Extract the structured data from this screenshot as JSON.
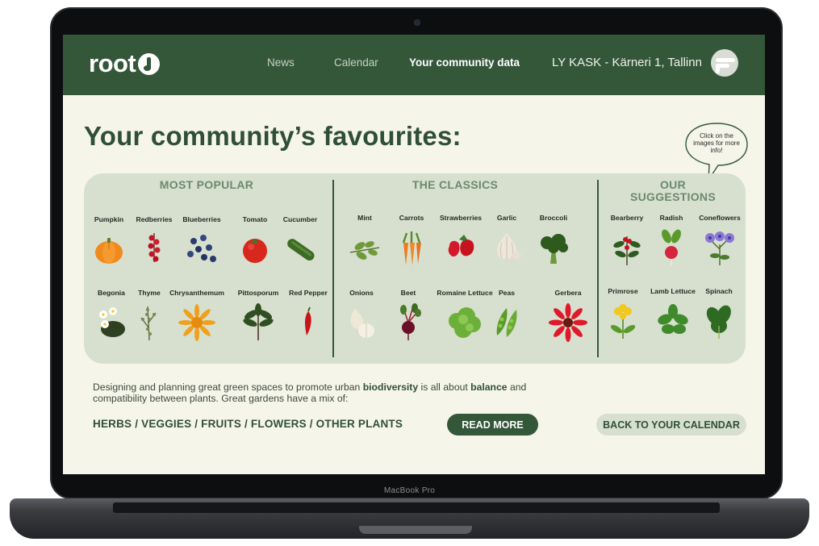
{
  "device": {
    "label": "MacBook Pro"
  },
  "app": {
    "logo_text": "root"
  },
  "nav": {
    "items": [
      {
        "label": "News",
        "active": false
      },
      {
        "label": "Calendar",
        "active": false
      },
      {
        "label": "Your community data",
        "active": true
      }
    ],
    "location": "LY KASK - Kärneri 1, Tallinn"
  },
  "page": {
    "title": "Your community’s favourites:",
    "tooltip": "Click on the images for more info!"
  },
  "sections": {
    "most_popular": {
      "heading": "MOST POPULAR",
      "plants": [
        {
          "name": "Pumpkin",
          "icon": "pumpkin-icon"
        },
        {
          "name": "Redberries",
          "icon": "redberries-icon"
        },
        {
          "name": "Blueberries",
          "icon": "blueberries-icon"
        },
        {
          "name": "Tomato",
          "icon": "tomato-icon"
        },
        {
          "name": "Cucumber",
          "icon": "cucumber-icon"
        },
        {
          "name": "Begonia",
          "icon": "begonia-icon"
        },
        {
          "name": "Thyme",
          "icon": "thyme-icon"
        },
        {
          "name": "Chrysanthemum",
          "icon": "chrysanthemum-icon"
        },
        {
          "name": "Pittosporum",
          "icon": "pittosporum-icon"
        },
        {
          "name": "Red Pepper",
          "icon": "red-pepper-icon"
        }
      ]
    },
    "classics": {
      "heading": "THE CLASSICS",
      "plants": [
        {
          "name": "Mint",
          "icon": "mint-icon"
        },
        {
          "name": "Carrots",
          "icon": "carrots-icon"
        },
        {
          "name": "Strawberries",
          "icon": "strawberries-icon"
        },
        {
          "name": "Garlic",
          "icon": "garlic-icon"
        },
        {
          "name": "Broccoli",
          "icon": "broccoli-icon"
        },
        {
          "name": "Onions",
          "icon": "onions-icon"
        },
        {
          "name": "Beet",
          "icon": "beet-icon"
        },
        {
          "name": "Romaine Lettuce",
          "icon": "romaine-lettuce-icon"
        },
        {
          "name": "Peas",
          "icon": "peas-icon"
        },
        {
          "name": "Gerbera",
          "icon": "gerbera-icon"
        }
      ]
    },
    "suggestions": {
      "heading_line1": "OUR",
      "heading_line2": "SUGGESTIONS",
      "plants": [
        {
          "name": "Bearberry",
          "icon": "bearberry-icon"
        },
        {
          "name": "Radish",
          "icon": "radish-icon"
        },
        {
          "name": "Coneflowers",
          "icon": "coneflowers-icon"
        },
        {
          "name": "Primrose",
          "icon": "primrose-icon"
        },
        {
          "name": "Lamb Lettuce",
          "icon": "lamb-lettuce-icon"
        },
        {
          "name": "Spinach",
          "icon": "spinach-icon"
        }
      ]
    }
  },
  "intro": {
    "part1": "Designing and planning great green spaces to promote urban ",
    "bold1": "biodiversity",
    "part2": " is all about ",
    "bold2": "balance",
    "part3": " and compatibility between plants. Great gardens have a mix of:"
  },
  "categories_line": "HERBS / VEGGIES / FRUITS / FLOWERS / OTHER PLANTS",
  "buttons": {
    "read_more": "READ MORE",
    "back_to_calendar": "BACK TO YOUR CALENDAR"
  },
  "colors": {
    "topbar": "#34573a",
    "background": "#f6f5ea",
    "panel": "#d7dfcf",
    "heading_text": "#2f4f37",
    "section_heading": "#6b8a6c"
  }
}
